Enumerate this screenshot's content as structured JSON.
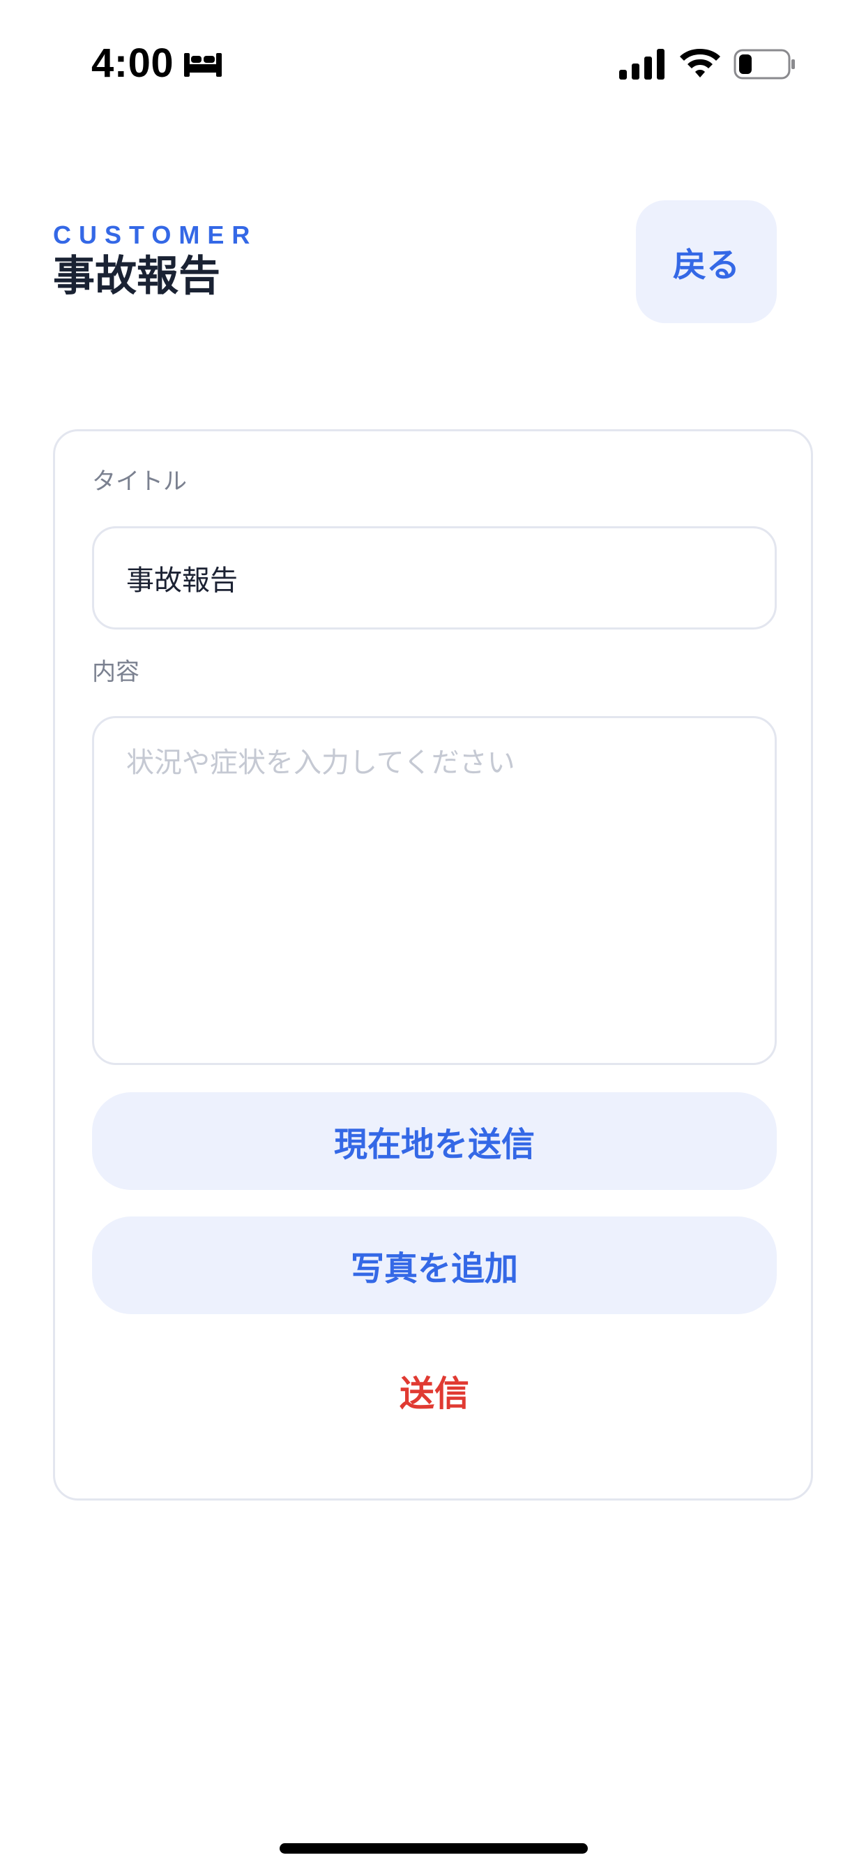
{
  "status_bar": {
    "time": "4:00",
    "icons": [
      "bed-icon",
      "cellular-signal-icon",
      "wifi-icon",
      "battery-icon"
    ]
  },
  "header": {
    "eyebrow": "CUSTOMER",
    "title": "事故報告",
    "back_label": "戻る"
  },
  "form": {
    "title_label": "タイトル",
    "title_value": "事故報告",
    "content_label": "内容",
    "content_placeholder": "状況や症状を入力してください",
    "content_value": "",
    "location_button": "現在地を送信",
    "photo_button": "写真を追加",
    "submit_button": "送信"
  },
  "colors": {
    "accent": "#3468e6",
    "accent_bg": "#edf1fd",
    "danger": "#e03a32",
    "border": "#e3e6ef",
    "label": "#7b8190",
    "placeholder": "#c5c9d3",
    "text": "#1c2233"
  }
}
